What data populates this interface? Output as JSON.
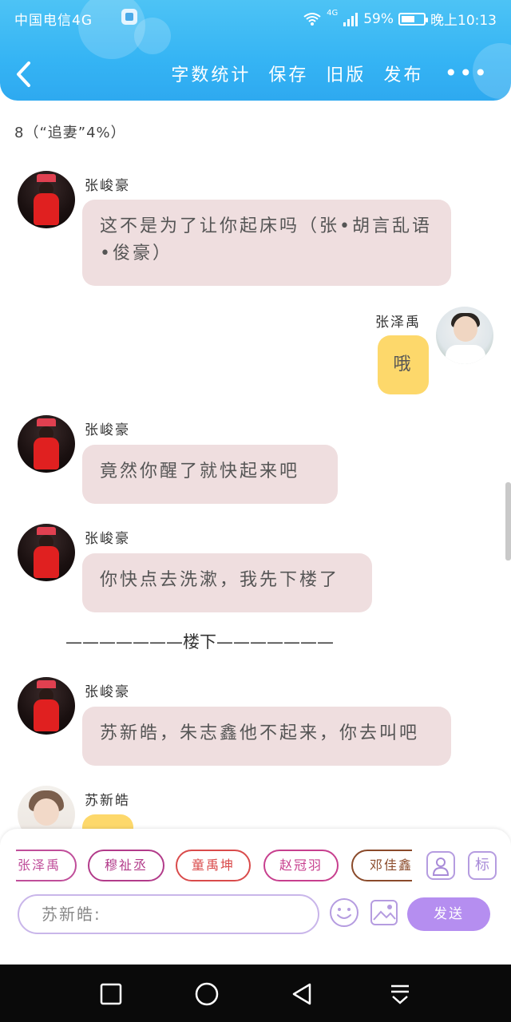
{
  "status_bar": {
    "carrier": "中国电信4G",
    "network": "4G",
    "battery": "59%",
    "time": "晚上10:13"
  },
  "header": {
    "back_icon": "chevron-left-icon",
    "actions": [
      "字数统计",
      "保存",
      "旧版",
      "发布"
    ],
    "more": "•••"
  },
  "chapter_title": "8（“追妻”4%）",
  "messages": [
    {
      "sender": "张峻豪",
      "text": "这不是为了让你起床吗（张•胡言乱语•俊豪）",
      "side": "left"
    },
    {
      "sender": "张泽禹",
      "text": "哦",
      "side": "right"
    },
    {
      "sender": "张峻豪",
      "text": "竟然你醒了就快起来吧",
      "side": "left"
    },
    {
      "sender": "张峻豪",
      "text": "你快点去洗漱，我先下楼了",
      "side": "left"
    },
    {
      "sender": "张峻豪",
      "text": "苏新皓，朱志鑫他不起来，你去叫吧",
      "side": "left"
    },
    {
      "sender": "苏新皓",
      "text": "",
      "side": "left"
    }
  ],
  "scene_divider": "———————楼下———————",
  "character_chips": [
    {
      "name": "张泽禹",
      "color": "#c04e9a"
    },
    {
      "name": "穆祉丞",
      "color": "#b23b8a"
    },
    {
      "name": "童禹坤",
      "color": "#d94b4b"
    },
    {
      "name": "赵冠羽",
      "color": "#c73f8e"
    },
    {
      "name": "邓佳鑫",
      "color": "#8a4a2a"
    }
  ],
  "composer": {
    "placeholder": "苏新皓:",
    "send_label": "发送",
    "tag_label": "标"
  }
}
